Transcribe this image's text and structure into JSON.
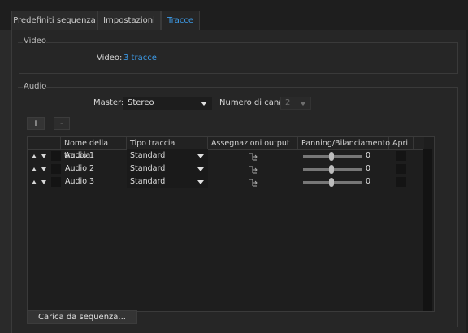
{
  "tabs": [
    {
      "label": "Predefiniti sequenza",
      "active": false
    },
    {
      "label": "Impostazioni",
      "active": false
    },
    {
      "label": "Tracce",
      "active": true
    }
  ],
  "video": {
    "group_title": "Video",
    "label": "Video:",
    "value": "3 tracce"
  },
  "audio": {
    "group_title": "Audio",
    "master_label": "Master:",
    "master_value": "Stereo",
    "channels_label": "Numero di canali:",
    "channels_value": "2",
    "add_label": "+",
    "remove_label": "-",
    "columns": [
      "Nome della traccia",
      "Tipo traccia",
      "Assegnazioni output",
      "Panning/Bilanciamento",
      "Apri"
    ],
    "tracks": [
      {
        "name": "Audio 1",
        "type": "Standard",
        "pan": "0"
      },
      {
        "name": "Audio 2",
        "type": "Standard",
        "pan": "0"
      },
      {
        "name": "Audio 3",
        "type": "Standard",
        "pan": "0"
      }
    ],
    "load_button": "Carica da sequenza..."
  },
  "colors": {
    "accent": "#3d9be8",
    "background": "#262626"
  }
}
